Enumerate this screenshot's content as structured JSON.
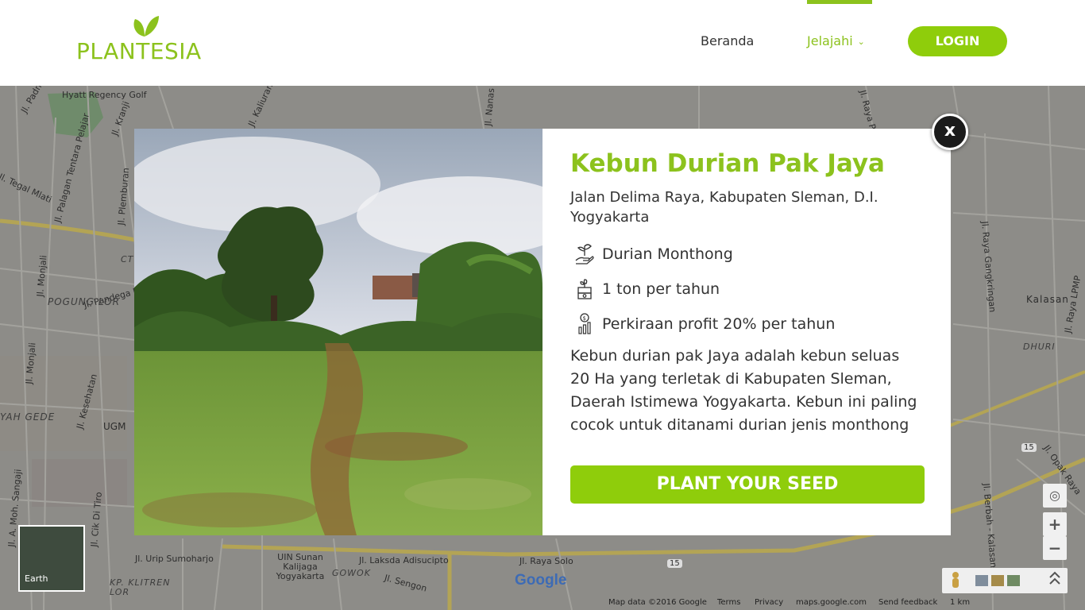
{
  "brand": {
    "name": "PLANTESIA",
    "color": "#8cc21d"
  },
  "nav": {
    "items": [
      {
        "label": "Beranda",
        "active": false
      },
      {
        "label": "Jelajahi",
        "active": true,
        "icon": "chevron-down-icon"
      }
    ],
    "login_label": "LOGIN"
  },
  "modal": {
    "close_label": "x",
    "title": "Kebun Durian Pak Jaya",
    "address": "Jalan Delima Raya, Kabupaten Sleman, D.I. Yogyakarta",
    "features": [
      {
        "icon": "seedling-hand-icon",
        "text": "Durian Monthong"
      },
      {
        "icon": "harvest-box-icon",
        "text": "1 ton per tahun"
      },
      {
        "icon": "profit-chart-icon",
        "text": "Perkiraan profit 20% per tahun"
      }
    ],
    "description": "Kebun durian pak Jaya adalah kebun seluas 20 Ha yang terletak di Kabupaten Sleman, Daerah Istimewa Yogyakarta. Kebun ini paling cocok untuk ditanami durian jenis monthong",
    "cta_label": "PLANT YOUR SEED",
    "accent": "#8fcd0b"
  },
  "map": {
    "labels": [
      "Hyatt Regency Golf",
      "Jl. Padma",
      "Jl. Palagan Tentara Pelajar",
      "Jl. Kranji",
      "Jl. Tegal Mlati",
      "Jl. Plemburan",
      "Jl. Monjali",
      "Jl. Pandega M",
      "POGUNG LOR",
      "Jl. Kesehatan",
      "UGM",
      "YAH GEDE",
      "Jl. A. Moh. Sangaji",
      "Jl. Cik Di Tiro",
      "Jl. Urip Sumoharjo",
      "UIN Sunan Kalijaga Yogyakarta",
      "GOWOK",
      "Jl. Laksda Adisucipto",
      "Jl. Sengon",
      "Jl. Raya Solo",
      "KP. KLITREN LOR",
      "Kalasan",
      "DHURI",
      "Jl. Raya Gangkringan",
      "Jl. Raya LPMP",
      "Jl. Opak Raya",
      "Jl. Berbah - Kalasan",
      "Jl. Nanas",
      "Jl. Kaliurang",
      "Jl. Raya Purw",
      "Jl. Monjali",
      "15",
      "CT"
    ],
    "earth_label": "Earth",
    "google_logo": "Google",
    "attribution": [
      "Map data ©2016 Google",
      "Terms",
      "Privacy",
      "maps.google.com",
      "Send feedback",
      "1 km"
    ]
  }
}
